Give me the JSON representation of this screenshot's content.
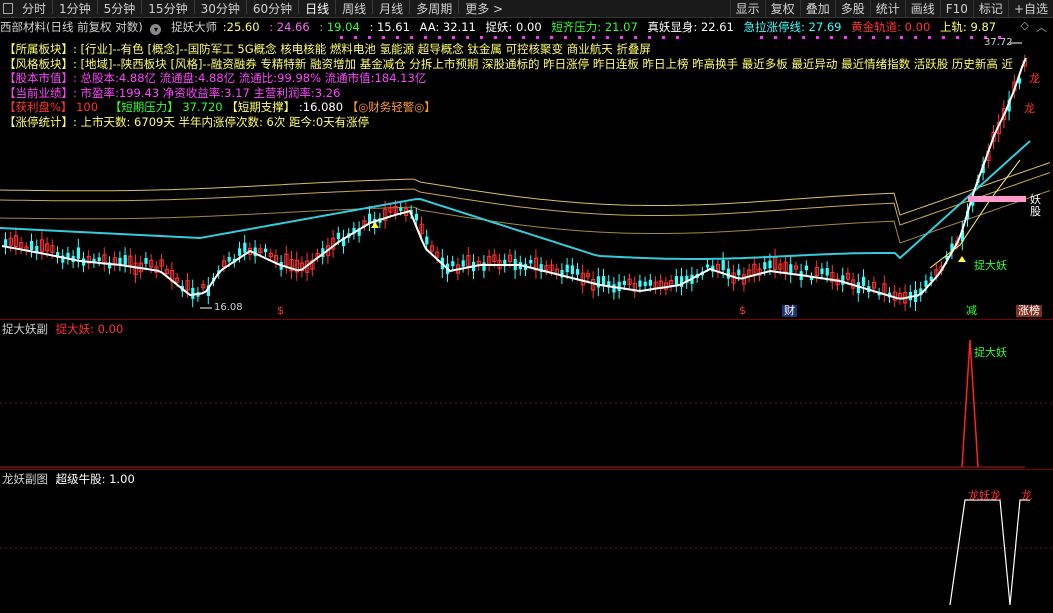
{
  "toolbar": {
    "left_items": [
      "分时",
      "1分钟",
      "5分钟",
      "15分钟",
      "30分钟",
      "60分钟",
      "日线",
      "周线",
      "月线",
      "多周期",
      "更多 >"
    ],
    "active_index": 6,
    "right_items": [
      "显示",
      "复权",
      "叠加",
      "多股",
      "统计",
      "画线",
      "F10",
      "标记",
      "+自选"
    ]
  },
  "header": {
    "stock": "西部材料(日线 前复权 对数)",
    "indicator": "捉妖大师",
    "values": [
      ":25.60",
      ": 24.66",
      ": 19.04",
      ": 15.61"
    ],
    "aa_label": "AA: 32.11",
    "zhuoyao": "捉妖: 0.00",
    "duanqi": "短齐压力: 21.07",
    "zhenyao": "真妖显身: 22.61",
    "jila": "急拉涨停线: 27.69",
    "huangjin": "黄金轨道: 0.00",
    "shanggui": "上轨: 9.87",
    "colors": {
      "v1": "#ffff66",
      "v2": "#ff66ff",
      "v3": "#33ff33",
      "v4": "#ffffff",
      "duanqi": "#33ff33",
      "zhenyao": "#ffffff",
      "jila": "#33ffff",
      "huangjin": "#ff3333",
      "shanggui": "#ffff66"
    }
  },
  "info": [
    {
      "label": "【所属板块】:",
      "text": "[行业]--有色 [概念]--国防军工 5G概念 核电核能 燃料电池 氢能源 超导概念 钛金属 可控核聚变 商业航天 折叠屏",
      "color": "#ffff66"
    },
    {
      "label": "【风格板块】:",
      "text": "[地域]--陕西板块 [风格]--融资融券 专精特新 融资增加 基金减仓 分拆上市预期 深股通标的 昨日涨停 昨日连板 昨日上榜 昨高换手 最近多板 最近异动 最近情绪指数 活跃股 历史新高 近",
      "color": "#ffff66"
    },
    {
      "label": "【股本市值】:",
      "text": "总股本:4.88亿 流通盘:4.88亿 流通比:99.98% 流通市值:184.13亿",
      "color": "#ff44ff"
    },
    {
      "label": "【当前业绩】:",
      "text": "市盈率:199.43 净资收益率:3.17 主营利润率:3.26",
      "color": "#ff44ff"
    }
  ],
  "info_row5": {
    "a_label": "【获利盘%】",
    "a_val": "100",
    "b_label": "【短期压力】",
    "b_val": "37.720",
    "c_label": "【短期支撑】",
    "c_val": ":16.080",
    "d_label": "【◎财务轻警◎】"
  },
  "info_row6": {
    "label": "【涨停统计】:",
    "text": "上市天数: 6709天 半年内涨停次数: 6次 距今:0天有涨停"
  },
  "main_chart": {
    "high_label": "37.72",
    "low_label": "16.08",
    "yaogu_label": "妖股",
    "zhuodayao_label": "捉大妖",
    "long_label": "龙",
    "long2_label": "龙",
    "jian_label": "减",
    "zhangbang_label": "涨榜",
    "cai_label": "财",
    "s_label": "$"
  },
  "panel2": {
    "title": "捉大妖副",
    "value_label": "捉大妖: 0.00",
    "marker": "捉大妖"
  },
  "panel3": {
    "title": "龙妖副图",
    "value_label": "超级牛股: 1.00",
    "marker1": "龙妖龙",
    "marker2": "龙"
  }
}
